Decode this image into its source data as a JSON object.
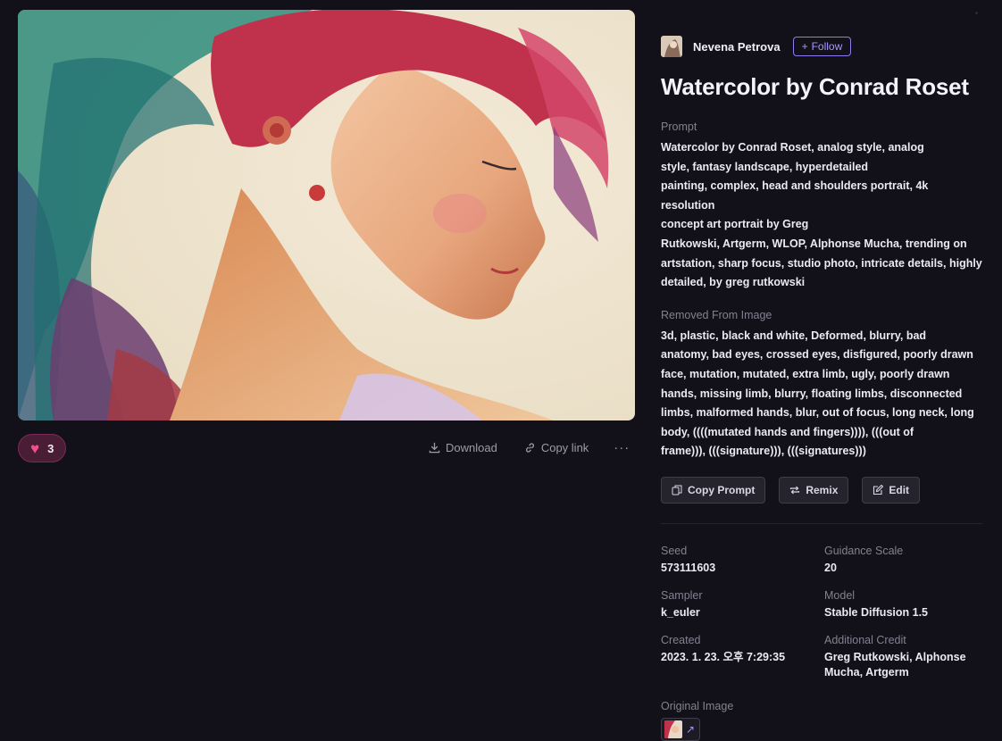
{
  "author": {
    "name": "Nevena Petrova",
    "follow_label": "Follow"
  },
  "title": "Watercolor by Conrad Roset",
  "prompt": {
    "label": "Prompt",
    "lines": [
      "Watercolor by Conrad Roset, analog style, analog",
      "style, fantasy landscape, hyperdetailed",
      "painting, complex, head and shoulders portrait, 4k resolution",
      "concept art portrait by Greg",
      "Rutkowski, Artgerm, WLOP, Alphonse Mucha, trending on",
      "artstation, sharp focus, studio photo, intricate details, highly",
      "detailed, by greg rutkowski"
    ]
  },
  "removed": {
    "label": "Removed From Image",
    "lines": [
      "3d, plastic, black and white, Deformed, blurry, bad",
      "anatomy, bad eyes, crossed eyes, disfigured, poorly drawn",
      "face, mutation, mutated, extra limb, ugly, poorly drawn",
      "hands, missing limb, blurry, floating limbs, disconnected",
      "limbs, malformed hands, blur, out of focus, long neck, long",
      "body, ((((mutated hands and fingers)))), (((out of",
      "frame))), (((signature))), (((signatures)))"
    ]
  },
  "buttons": {
    "copy_prompt": "Copy Prompt",
    "remix": "Remix",
    "edit": "Edit"
  },
  "actions": {
    "likes": "3",
    "download": "Download",
    "copy_link": "Copy link",
    "more": "···"
  },
  "meta": {
    "seed_label": "Seed",
    "seed": "573111603",
    "guidance_label": "Guidance Scale",
    "guidance": "20",
    "sampler_label": "Sampler",
    "sampler": "k_euler",
    "model_label": "Model",
    "model": "Stable Diffusion 1.5",
    "created_label": "Created",
    "created": "2023. 1. 23. 오후 7:29:35",
    "credit_label": "Additional Credit",
    "credit_line1": "Greg Rutkowski, Alphonse",
    "credit_line2": "Mucha, Artgerm"
  },
  "original_image_label": "Original Image",
  "icons": [
    "heart-icon",
    "download-icon",
    "link-icon",
    "more-icon",
    "plus-icon",
    "copy-icon",
    "remix-icon",
    "edit-icon",
    "external-arrow-icon"
  ],
  "colors": {
    "background": "#12111a",
    "accent": "#a795ff",
    "like": "#f04f8a"
  }
}
